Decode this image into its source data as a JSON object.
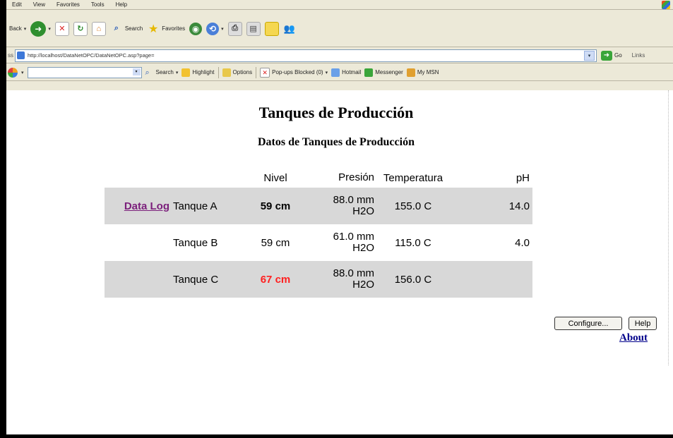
{
  "browser": {
    "menu": [
      "Edit",
      "View",
      "Favorites",
      "Tools",
      "Help"
    ],
    "toolbar": {
      "back_label": "Back",
      "search_label": "Search",
      "favorites_label": "Favorites"
    },
    "address": {
      "label": "ss",
      "url": "http://localhost/DataNetOPC/DataNetOPC.asp?page=",
      "go_label": "Go",
      "links_label": "Links"
    },
    "msn_toolbar": {
      "search_label": "Search",
      "highlight_label": "Highlight",
      "options_label": "Options",
      "popups_label": "Pop-ups Blocked (0)",
      "hotmail_label": "Hotmail",
      "messenger_label": "Messenger",
      "mymsn_label": "My MSN"
    }
  },
  "page": {
    "title": "Tanques de Producción",
    "subtitle": "Datos de Tanques de Producción",
    "table": {
      "headers": {
        "nivel": "Nivel",
        "presion": "Presión",
        "temperatura": "Temperatura",
        "ph": "pH"
      },
      "rows": [
        {
          "link": "Data Log",
          "name": "Tanque A",
          "nivel": "59 cm",
          "presion_1": "88.0 mm",
          "presion_2": "H2O",
          "temperatura": "155.0 C",
          "ph": "14.0"
        },
        {
          "link": "",
          "name": "Tanque B",
          "nivel": "59 cm",
          "presion_1": "61.0 mm",
          "presion_2": "H2O",
          "temperatura": "115.0 C",
          "ph": "4.0"
        },
        {
          "link": "",
          "name": "Tanque C",
          "nivel": "67 cm",
          "presion_1": "88.0 mm",
          "presion_2": "H2O",
          "temperatura": "156.0 C",
          "ph": ""
        }
      ]
    },
    "buttons": {
      "configure": "Configure...",
      "help": "Help",
      "about": "About"
    },
    "colors": {
      "alarm": "#ff2020",
      "row_shade": "#d8d8d8",
      "link_visited": "#7b1f7b",
      "link": "#00008b"
    }
  }
}
